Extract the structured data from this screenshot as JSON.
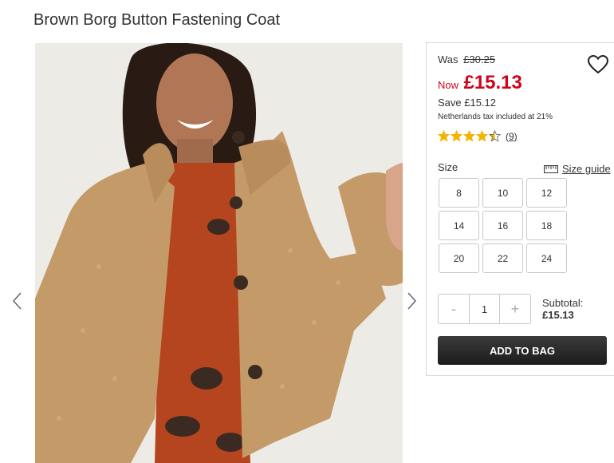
{
  "product": {
    "title": "Brown Borg Button Fastening Coat"
  },
  "price": {
    "was_label": "Was",
    "was_value": "£30.25",
    "now_label": "Now",
    "now_value": "£15.13",
    "save_text": "Save £15.12",
    "tax_text": "Netherlands tax included at 21%",
    "color_sale": "#d0021b"
  },
  "rating": {
    "stars": 4.5,
    "max": 5,
    "review_count": "(9)",
    "star_color": "#f5b301"
  },
  "size": {
    "label": "Size",
    "guide_label": "Size guide",
    "options": [
      "8",
      "10",
      "12",
      "14",
      "16",
      "18",
      "20",
      "22",
      "24"
    ]
  },
  "quantity": {
    "minus": "-",
    "value": "1",
    "plus": "+"
  },
  "subtotal": {
    "label": "Subtotal:",
    "value": "£15.13"
  },
  "cart": {
    "add_label": "ADD TO BAG"
  },
  "icons": {
    "prev": "chevron-left-icon",
    "next": "chevron-right-icon",
    "wishlist": "heart-icon",
    "size_guide": "ruler-icon"
  }
}
